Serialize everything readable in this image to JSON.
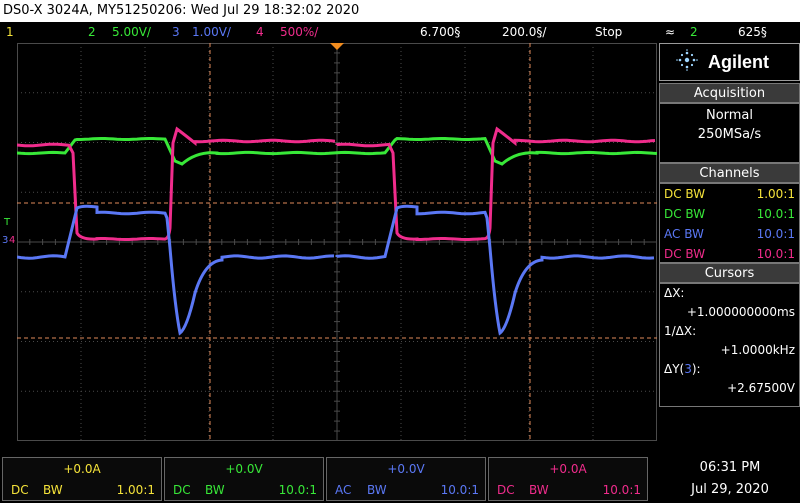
{
  "title_bar": "DS0-X 3024A, MY51250206: Wed Jul 29 18:32:02 2020",
  "status_row": {
    "ch1_num": "1",
    "ch2_num": "2",
    "ch2_scale": "5.00V/",
    "ch3_num": "3",
    "ch3_scale": "1.00V/",
    "ch4_num": "4",
    "ch4_scale": "500%/",
    "time_delay": "6.700§",
    "time_scale": "200.0§/",
    "run_state": "Stop",
    "trigger_icon": "≈",
    "trigger_src": "2",
    "trigger_level": "625§"
  },
  "colors": {
    "ch1": "#f5e33a",
    "ch2": "#38e838",
    "ch3": "#5b78f5",
    "ch4": "#f02c8c",
    "cursor": "#e08a5a",
    "grid": "#4a4a4a",
    "trigger_marker": "#f28c1e"
  },
  "panel": {
    "brand": "Agilent",
    "acquisition_title": "Acquisition",
    "acq_mode": "Normal",
    "acq_rate": "250MSa/s",
    "channels_title": "Channels",
    "channels": [
      {
        "coupling": "DC BW",
        "probe": "1.00:1"
      },
      {
        "coupling": "DC BW",
        "probe": "10.0:1"
      },
      {
        "coupling": "AC BW",
        "probe": "10.0:1"
      },
      {
        "coupling": "DC BW",
        "probe": "10.0:1"
      }
    ],
    "cursors_title": "Cursors",
    "dx_label": "ΔX:",
    "dx_value": "+1.000000000ms",
    "inv_dx_label": "1/ΔX:",
    "inv_dx_value": "+1.0000kHz",
    "dy_label_prefix": "ΔY(",
    "dy_channel": "3",
    "dy_label_suffix": "):",
    "dy_value": "+2.67500V"
  },
  "bottom": {
    "channels": [
      {
        "offset": "+0.0A",
        "coupling": "DC",
        "bw": "BW",
        "probe": "1.00:1"
      },
      {
        "offset": "+0.0V",
        "coupling": "DC",
        "bw": "BW",
        "probe": "10.0:1"
      },
      {
        "offset": "+0.0V",
        "coupling": "AC",
        "bw": "BW",
        "probe": "10.0:1"
      },
      {
        "offset": "+0.0A",
        "coupling": "DC",
        "bw": "BW",
        "probe": "10.0:1"
      }
    ],
    "time": "06:31 PM",
    "date": "Jul 29, 2020"
  },
  "left_markers": {
    "trigger": "T",
    "ch3_marker": "3",
    "ch4_marker": "4"
  }
}
